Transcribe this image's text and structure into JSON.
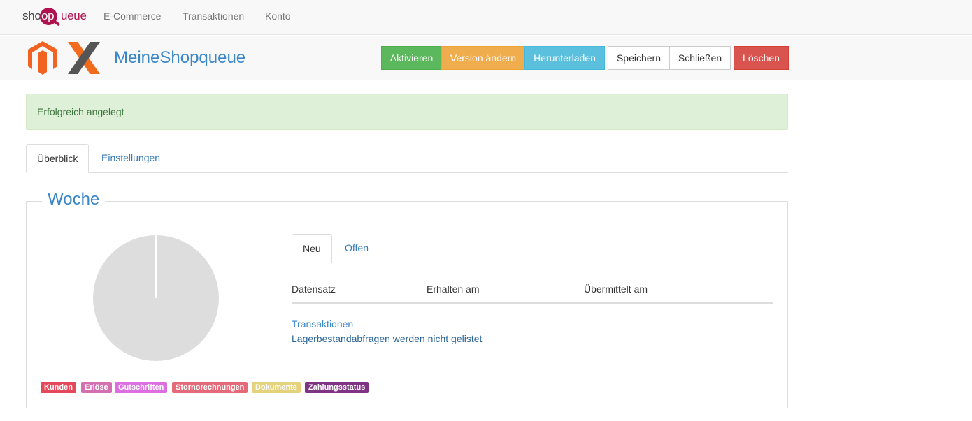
{
  "navbar": {
    "brand": {
      "part1": "shop",
      "part2": "op",
      "part3": "ueue"
    },
    "links": [
      "E-Commerce",
      "Transaktionen",
      "Konto"
    ]
  },
  "header": {
    "title": "MeineShopqueue",
    "buttons": {
      "activate": "Aktivieren",
      "change_version": "Version ändern",
      "download": "Herunterladen",
      "save": "Speichern",
      "close": "Schließen",
      "delete": "Löschen"
    }
  },
  "alert": {
    "message": "Erfolgreich angelegt"
  },
  "tabs": {
    "overview": "Überblick",
    "settings": "Einstellungen"
  },
  "week": {
    "legend": "Woche",
    "chart_labels": [
      {
        "text": "Kunden",
        "color": "#e4495b"
      },
      {
        "text": "Erlöse",
        "color": "#d46fb2"
      },
      {
        "text": "Gutschriften",
        "color": "#dd6ee2"
      },
      {
        "text": "Stornorechnungen",
        "color": "#e46a7a"
      },
      {
        "text": "Dokumente",
        "color": "#e5d27c"
      },
      {
        "text": "Zahlungsstatus",
        "color": "#7e3482"
      }
    ],
    "inner_tabs": {
      "new": "Neu",
      "open": "Offen"
    },
    "table": {
      "headers": [
        "Datensatz",
        "Erhalten am",
        "Übermittelt am"
      ],
      "link_transactions": "Transaktionen",
      "note": "Lagerbestandabfragen werden nicht gelistet"
    }
  },
  "colors": {
    "brand": "#b0124f",
    "primary_text": "#3a87c8",
    "success_bg": "#dff0d8",
    "pie_fill": "#dddddd"
  }
}
